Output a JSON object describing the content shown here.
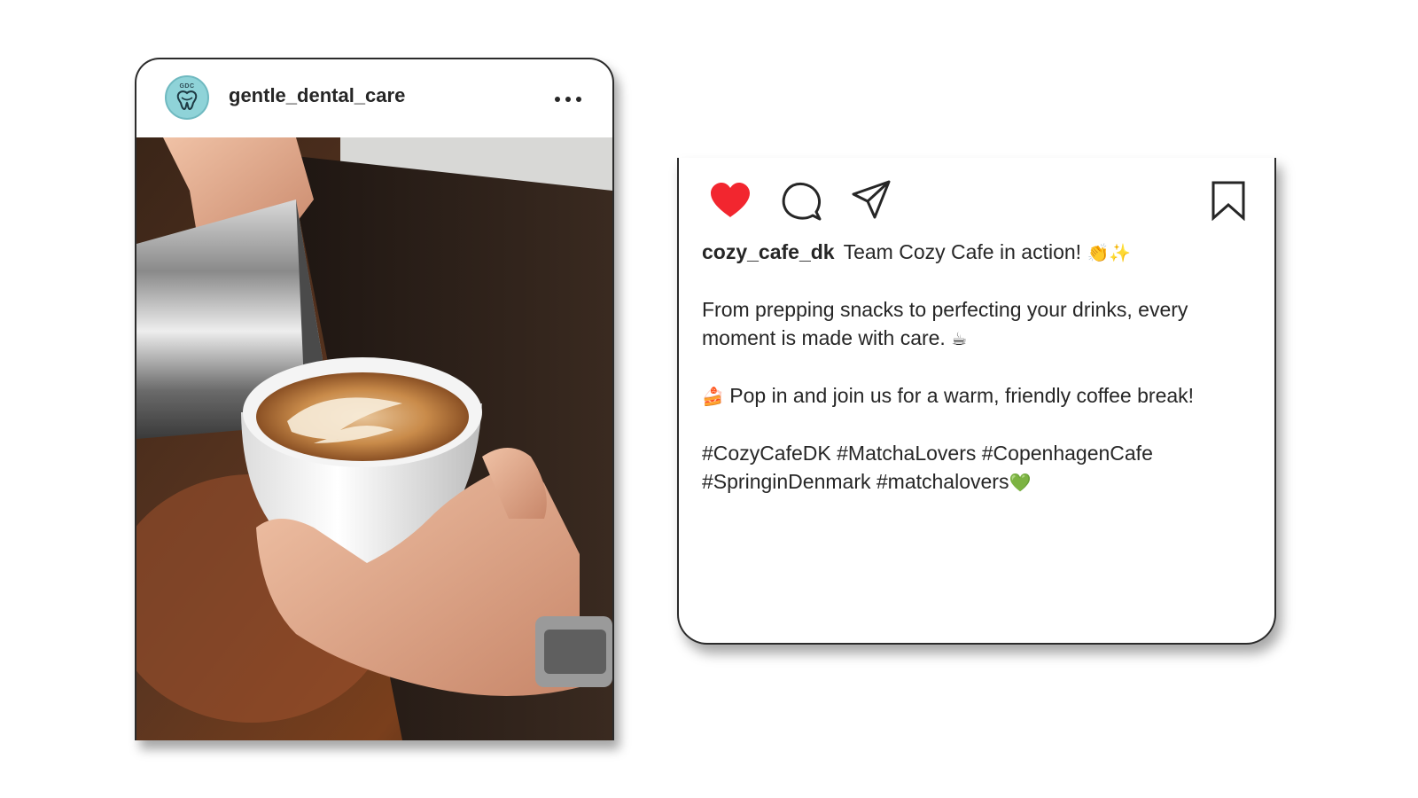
{
  "post": {
    "username": "gentle_dental_care",
    "avatar_initials": "GDC",
    "photo_description_icon": "latte-art-photo"
  },
  "caption": {
    "username": "cozy_cafe_dk",
    "headline": "Team Cozy Cafe in action!",
    "headline_emoji": "👏✨",
    "paragraph_1": "From prepping snacks to perfecting your drinks, every moment is made with care.",
    "paragraph_1_emoji": "☕",
    "paragraph_2_emoji": "🍰",
    "paragraph_2": "Pop in and join us for a warm, friendly coffee break!",
    "hashtags_line_1": "#CozyCafeDK #MatchaLovers #CopenhagenCafe",
    "hashtags_line_2": "#SpringinDenmark #matchalovers",
    "hashtags_emoji": "💚"
  },
  "actions": {
    "like_icon": "heart-filled-icon",
    "comment_icon": "comment-bubble-icon",
    "share_icon": "paper-plane-icon",
    "save_icon": "bookmark-icon"
  },
  "colors": {
    "like": "#f2262f",
    "text": "#262626",
    "avatar_bg": "#8fd3d8"
  }
}
